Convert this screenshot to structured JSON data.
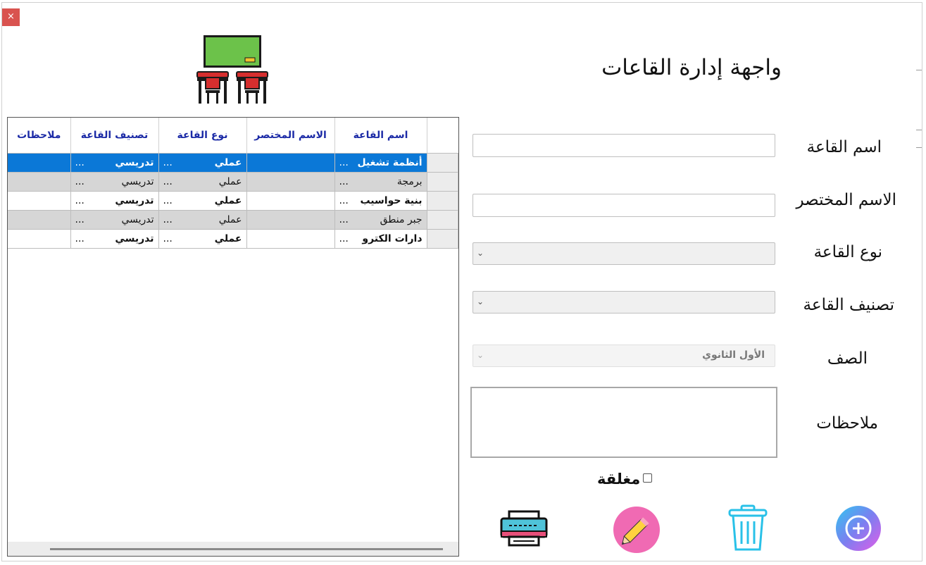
{
  "window": {
    "title": "واجهة إدارة القاعات",
    "close_glyph": "×"
  },
  "grid": {
    "columns": [
      "اسم القاعة",
      "الاسم المختصر",
      "نوع القاعة",
      "تصنيف القاعة",
      "ملاحظات"
    ],
    "rows": [
      {
        "name": "أنظمة تشغيل",
        "short": "",
        "type": "عملي",
        "category": "تدريسي",
        "notes": ""
      },
      {
        "name": "برمجة",
        "short": "",
        "type": "عملي",
        "category": "تدريسي",
        "notes": ""
      },
      {
        "name": "بنية حواسيب",
        "short": "",
        "type": "عملي",
        "category": "تدريسي",
        "notes": ""
      },
      {
        "name": "جبر منطق",
        "short": "",
        "type": "عملي",
        "category": "تدريسي",
        "notes": ""
      },
      {
        "name": "دارات الكترو",
        "short": "",
        "type": "عملي",
        "category": "تدريسي",
        "notes": ""
      }
    ],
    "ellipsis": "..."
  },
  "form": {
    "hall_name_label": "اسم القاعة",
    "hall_name_value": "",
    "short_name_label": "الاسم المختصر",
    "short_name_value": "",
    "hall_type_label": "نوع القاعة",
    "hall_type_value": "",
    "hall_category_label": "تصنيف القاعة",
    "hall_category_value": "",
    "grade_label": "الصف",
    "grade_value": "الأول الثانوي",
    "notes_label": "ملاحظات",
    "notes_value": "",
    "closed_label": "مغلقة",
    "closed_checked": false
  },
  "actions": {
    "icons": [
      "printer-icon",
      "edit-pencil-icon",
      "trash-icon",
      "add-icon"
    ]
  },
  "colors": {
    "selected_row": "#0b78d7",
    "alt_row": "#d6d6d6",
    "header_text": "#1b2aa6",
    "close_button": "#d9534f"
  }
}
